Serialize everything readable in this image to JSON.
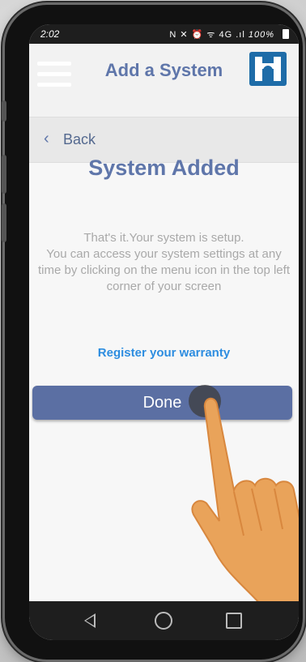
{
  "status_bar": {
    "time": "2:02",
    "icons_text": "N ✕ ⏰ ᯤ 4G .ıl",
    "battery": "100%"
  },
  "app_bar": {
    "title": "Add a System",
    "menu_icon": "hamburger-icon",
    "logo_icon": "h-logo-icon"
  },
  "back": {
    "label": "Back",
    "icon": "chevron-left-icon"
  },
  "content": {
    "heading": "System Added",
    "message_lines": [
      "That's it.Your system is setup.",
      "You can access your system settings at any",
      "time by clicking on the menu icon in the top left",
      "corner of your screen"
    ],
    "register_link": "Register your warranty",
    "done_label": "Done"
  },
  "colors": {
    "accent": "#5f76aa",
    "button": "#5b6fa3",
    "link": "#2d8de0",
    "logo": "#1e6ca8",
    "hand": "#e9a35a"
  },
  "nav_bar": {
    "back_icon": "triangle-back-icon",
    "home_icon": "circle-home-icon",
    "recent_icon": "square-recent-icon"
  }
}
